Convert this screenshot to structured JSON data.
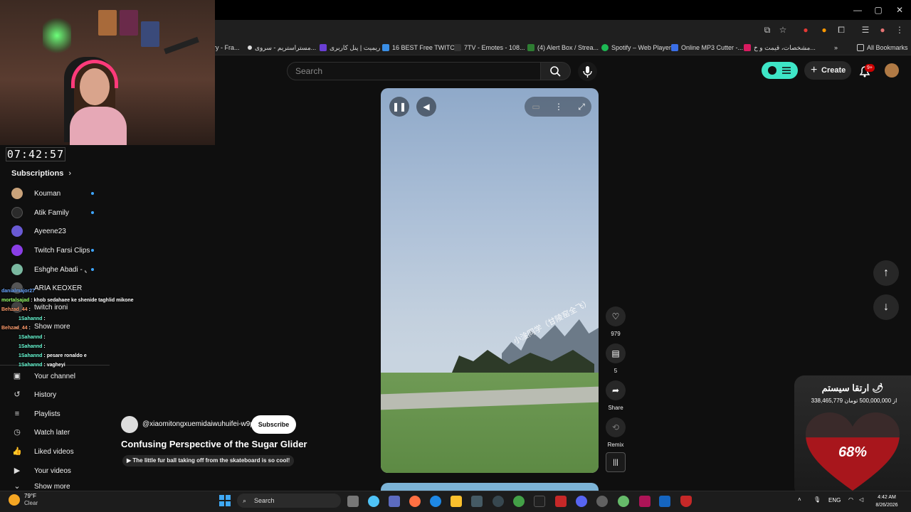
{
  "window": {
    "minimize": "—",
    "maximize": "▢",
    "close": "✕"
  },
  "bookmarks": {
    "items": [
      {
        "label": "ry - Fra...",
        "color": "#444444"
      },
      {
        "label": "مستراستریم - سروی...",
        "color": "#1f1f1f"
      },
      {
        "label": "ریمیت | پنل کاربری",
        "color": "#6a3fd4"
      },
      {
        "label": "16 BEST Free TWITC...",
        "color": "#3a8ee6"
      },
      {
        "label": "7TV - Emotes - 108...",
        "color": "#333333"
      },
      {
        "label": "(4) Alert Box / Strea...",
        "color": "#2e7d32"
      },
      {
        "label": "Spotify – Web Player",
        "color": "#1db954"
      },
      {
        "label": "Online MP3 Cutter -...",
        "color": "#3a6ee6"
      },
      {
        "label": "مشخصات، قیمت و خ...",
        "color": "#d81b60"
      }
    ],
    "all_bookmarks": "All Bookmarks"
  },
  "header": {
    "search_placeholder": "Search",
    "create_label": "Create",
    "notification_badge": "9+"
  },
  "stream": {
    "timer": "07:42:57"
  },
  "sidebar": {
    "subscriptions_title": "Subscriptions",
    "subscriptions": [
      {
        "name": "Kouman",
        "color": "#c9a27a",
        "dot": true
      },
      {
        "name": "Atik Family",
        "color": "#2b2b2b",
        "dot": true
      },
      {
        "name": "Ayeene23",
        "color": "#6a5ad4",
        "dot": false
      },
      {
        "name": "Twitch Farsi Clips",
        "color": "#8a3ee6",
        "dot": true
      },
      {
        "name": "Eshghe Abadi - عشق ابدی",
        "color": "#7ab8a0",
        "dot": true
      },
      {
        "name": "ARIA KEOXER",
        "color": "#555555",
        "dot": false
      },
      {
        "name": "twitch ironi",
        "color": "#444444",
        "dot": false
      },
      {
        "name": "Show more",
        "color": "",
        "dot": false
      }
    ],
    "you_items": [
      {
        "name": "Your channel",
        "icon": "person-box-icon"
      },
      {
        "name": "History",
        "icon": "history-icon"
      },
      {
        "name": "Playlists",
        "icon": "playlist-icon"
      },
      {
        "name": "Watch later",
        "icon": "clock-icon"
      },
      {
        "name": "Liked videos",
        "icon": "thumbs-up-icon"
      },
      {
        "name": "Your videos",
        "icon": "video-icon"
      },
      {
        "name": "Show more",
        "icon": "chevron-down-icon"
      }
    ]
  },
  "chat": [
    {
      "user": "danialmajor27",
      "user_color": "#6aa6ff",
      "msg": ""
    },
    {
      "user": "mortalsajad",
      "user_color": "#9aff6a",
      "msg": "khob sedahaee ke shenide taghlid mikone"
    },
    {
      "user": "Behzad_44",
      "user_color": "#ff9a6a",
      "msg": ""
    },
    {
      "user": "1Sahannd",
      "user_color": "#6affd8",
      "msg": ""
    },
    {
      "user": "Behzad_44",
      "user_color": "#ff9a6a",
      "msg": ""
    },
    {
      "user": "1Sahannd",
      "user_color": "#6affd8",
      "msg": ""
    },
    {
      "user": "1Sahannd",
      "user_color": "#6affd8",
      "msg": ""
    },
    {
      "user": "1Sahannd",
      "user_color": "#6affd8",
      "msg": "pesare ronaldo e"
    },
    {
      "user": "1Sahannd",
      "user_color": "#6affd8",
      "msg": "vagheyi"
    }
  ],
  "video": {
    "watermark": "小淦同学（甘陵窑全飞）",
    "channel": "@xiaomitongxuemidaiwuhuifei-w9p",
    "subscribe": "Subscribe",
    "title": "Confusing Perspective of the Sugar Glider",
    "chip": "The little fur ball taking off from the skateboard is so cool!",
    "likes": "979",
    "comments": "5",
    "share": "Share",
    "remix": "Remix"
  },
  "donation": {
    "title": "ارتقا سیستم 🌶",
    "amount": "338,465,779 از 500,000,000 تومان",
    "progress": 0.68,
    "percent_label": "68%"
  },
  "taskbar": {
    "temperature": "79°F",
    "weather": "Clear",
    "search": "Search",
    "language": "ENG",
    "time": "4:42 AM",
    "date": "8/26/2026"
  }
}
